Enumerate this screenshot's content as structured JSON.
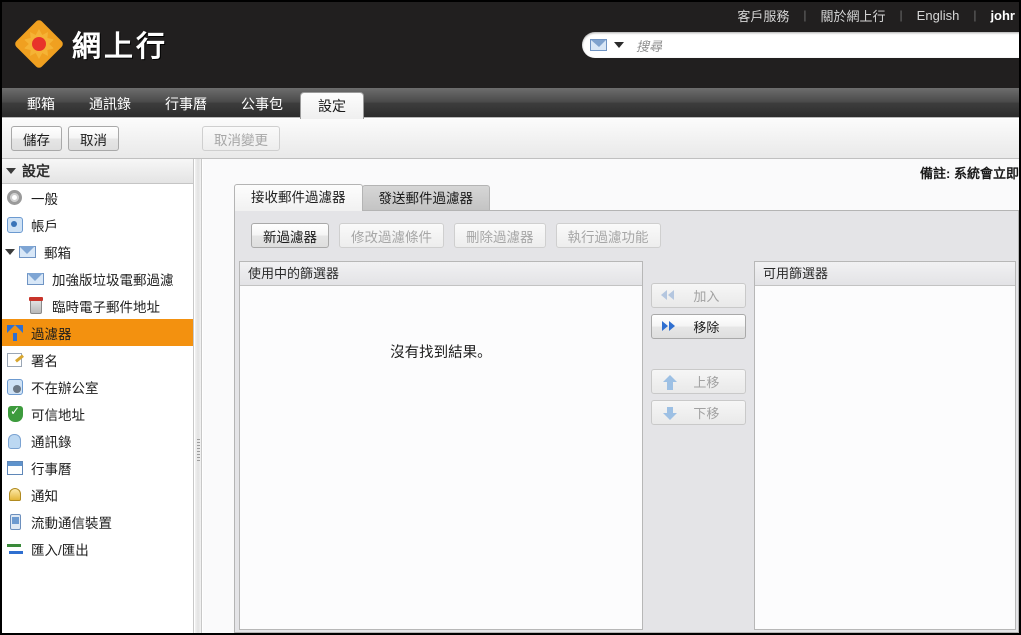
{
  "header": {
    "links": [
      {
        "label": "客戶服務",
        "name": "customer-service"
      },
      {
        "label": "關於網上行",
        "name": "about-netvigator"
      },
      {
        "label": "English",
        "name": "english"
      }
    ],
    "separator": "|",
    "user": "johr",
    "brand_name": "網上行",
    "search": {
      "placeholder": "搜尋",
      "value": ""
    }
  },
  "nav": {
    "tabs": [
      {
        "label": "郵箱",
        "name": "mail"
      },
      {
        "label": "通訊錄",
        "name": "contacts"
      },
      {
        "label": "行事曆",
        "name": "calendar"
      },
      {
        "label": "公事包",
        "name": "briefcase"
      },
      {
        "label": "設定",
        "name": "preferences",
        "active": true
      }
    ]
  },
  "toolbar": {
    "save_label": "儲存",
    "cancel_label": "取消",
    "undo_label": "取消變更"
  },
  "sidebar": {
    "title": "設定",
    "items": [
      {
        "label": "一般",
        "icon": "gear-icon",
        "level": 1
      },
      {
        "label": "帳戶",
        "icon": "account-icon",
        "level": 1
      },
      {
        "label": "郵箱",
        "icon": "envelope-icon",
        "level": 1,
        "expandable": true
      },
      {
        "label": "加強版垃圾電郵過濾",
        "icon": "envelope-icon",
        "level": 2
      },
      {
        "label": "臨時電子郵件地址",
        "icon": "trash-icon",
        "level": 2
      },
      {
        "label": "過濾器",
        "icon": "funnel-icon",
        "level": 1,
        "selected": true
      },
      {
        "label": "署名",
        "icon": "signature-icon",
        "level": 1
      },
      {
        "label": "不在辦公室",
        "icon": "out-of-office-icon",
        "level": 1
      },
      {
        "label": "可信地址",
        "icon": "shield-icon",
        "level": 1
      },
      {
        "label": "通訊錄",
        "icon": "contact-icon",
        "level": 1
      },
      {
        "label": "行事曆",
        "icon": "calendar-icon",
        "level": 1
      },
      {
        "label": "通知",
        "icon": "bell-icon",
        "level": 1
      },
      {
        "label": "流動通信裝置",
        "icon": "mobile-icon",
        "level": 1
      },
      {
        "label": "匯入/匯出",
        "icon": "import-export-icon",
        "level": 1
      }
    ]
  },
  "main": {
    "note": "備註: 系統會立即",
    "tabs": [
      {
        "label": "接收郵件過濾器",
        "name": "incoming-filters",
        "active": true
      },
      {
        "label": "發送郵件過濾器",
        "name": "outgoing-filters",
        "active": false
      }
    ],
    "filter_buttons": [
      {
        "label": "新過濾器",
        "name": "new-filter",
        "enabled": true
      },
      {
        "label": "修改過濾條件",
        "name": "edit-filter",
        "enabled": false
      },
      {
        "label": "刪除過濾器",
        "name": "delete-filter",
        "enabled": false
      },
      {
        "label": "執行過濾功能",
        "name": "run-filter",
        "enabled": false
      }
    ],
    "active_list": {
      "header": "使用中的篩選器",
      "empty_text": "沒有找到結果。",
      "rows": []
    },
    "available_list": {
      "header": "可用篩選器",
      "rows": []
    },
    "transfer_buttons": [
      {
        "label": "加入",
        "name": "add-button",
        "enabled": false,
        "icon": "chevron-left-double-icon"
      },
      {
        "label": "移除",
        "name": "remove-button",
        "enabled": true,
        "icon": "chevron-right-double-icon"
      },
      {
        "label": "上移",
        "name": "move-up-button",
        "enabled": false,
        "icon": "arrow-up-icon"
      },
      {
        "label": "下移",
        "name": "move-down-button",
        "enabled": false,
        "icon": "arrow-down-icon"
      }
    ]
  },
  "colors": {
    "header_bg": "#211f1f",
    "selection_orange": "#f3910f",
    "accent_blue": "#2f6fd0",
    "brand_orange": "#f0a020",
    "brand_red": "#e8342a"
  }
}
